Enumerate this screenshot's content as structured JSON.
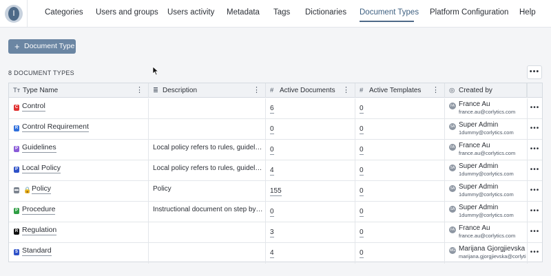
{
  "logo": {
    "letter": "I"
  },
  "nav": [
    {
      "label": "Categories"
    },
    {
      "label": "Users and groups"
    },
    {
      "label": "Users activity"
    },
    {
      "label": "Metadata"
    },
    {
      "label": "Tags"
    },
    {
      "label": "Dictionaries"
    },
    {
      "label": "Document Types",
      "active": true
    },
    {
      "label": "Platform Configuration"
    },
    {
      "label": "Help"
    }
  ],
  "toolbar": {
    "add_label": "Document Type",
    "add_icon": "+"
  },
  "list": {
    "count_label": "8 DOCUMENT TYPES",
    "more_icon": "•••"
  },
  "table": {
    "columns": [
      {
        "icon": "Tт",
        "label": "Type Name",
        "menu": "⋮"
      },
      {
        "icon": "≣",
        "label": "Description",
        "menu": "⋮"
      },
      {
        "icon": "#",
        "label": "Active Documents",
        "menu": "⋮"
      },
      {
        "icon": "#",
        "label": "Active Templates",
        "menu": "⋮"
      },
      {
        "icon": "◎",
        "label": "Created by"
      }
    ],
    "row_menu": "•••",
    "rows": [
      {
        "badge": "C",
        "badge_color": "#e03131",
        "name": "Control",
        "description": "",
        "active_documents": "6",
        "active_templates": "0",
        "initials": "FA",
        "creator": "France Au",
        "email": "france.au@corlytics.com"
      },
      {
        "badge": "R",
        "badge_color": "#2f6fdc",
        "name": "Control Requirement",
        "description": "",
        "active_documents": "0",
        "active_templates": "0",
        "initials": "SA",
        "creator": "Super Admin",
        "email": "1dummy@corlytics.com"
      },
      {
        "badge": "P",
        "badge_color": "#8a5cd8",
        "name": "Guidelines",
        "description": "Local policy refers to rules, guideline...",
        "active_documents": "0",
        "active_templates": "0",
        "initials": "FA",
        "creator": "France Au",
        "email": "france.au@corlytics.com"
      },
      {
        "badge": "P",
        "badge_color": "#2f52c8",
        "name": "Local Policy",
        "description": "Local policy refers to rules, guideline...",
        "active_documents": "4",
        "active_templates": "0",
        "initials": "SA",
        "creator": "Super Admin",
        "email": "1dummy@corlytics.com"
      },
      {
        "badge": "▬",
        "badge_color": "#7d8590",
        "name": "Policy",
        "locked": true,
        "lock_icon": "🔒",
        "description": "Policy",
        "active_documents": "155",
        "active_templates": "0",
        "initials": "SA",
        "creator": "Super Admin",
        "email": "1dummy@corlytics.com"
      },
      {
        "badge": "P",
        "badge_color": "#2f9e44",
        "name": "Procedure",
        "description": "Instructional document on step by s...",
        "active_documents": "0",
        "active_templates": "0",
        "initials": "SA",
        "creator": "Super Admin",
        "email": "1dummy@corlytics.com"
      },
      {
        "badge": "R",
        "badge_color": "#111111",
        "name": "Regulation",
        "description": "",
        "active_documents": "3",
        "active_templates": "0",
        "initials": "FA",
        "creator": "France Au",
        "email": "france.au@corlytics.com"
      },
      {
        "badge": "S",
        "badge_color": "#2f52c8",
        "name": "Standard",
        "description": "",
        "active_documents": "4",
        "active_templates": "0",
        "initials": "MG",
        "creator": "Marijana Gjorgjievska",
        "email": "marijana.gjorgjievska@corlytics.com"
      }
    ]
  }
}
